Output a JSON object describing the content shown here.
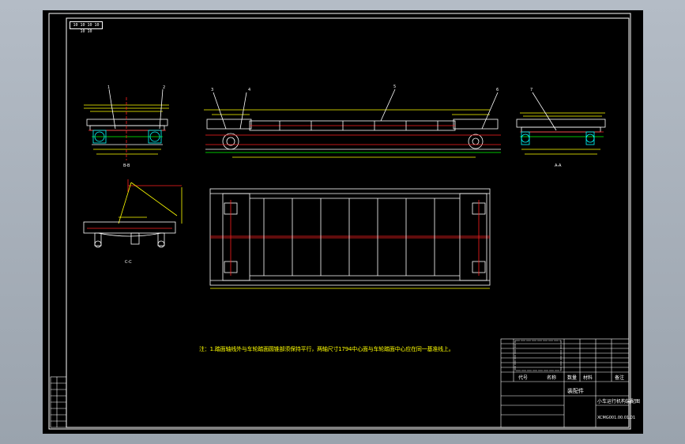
{
  "drawing": {
    "code_box": "10 10 10 10 10 10",
    "note": "注：1.踏面轴线外与车轮踏面圆锥部须保持平行，两轴尺寸1794中心面与车轮踏面中心应在同一基准线上。",
    "section_labels": [
      "B-B",
      "A-A",
      "C-C",
      "D-D"
    ],
    "part_numbers": [
      "1",
      "2",
      "3",
      "4",
      "5",
      "6",
      "7"
    ]
  },
  "title_block": {
    "header_cols": [
      "代号",
      "名称",
      "数量",
      "材料",
      "备注"
    ],
    "mid_label": "装配件",
    "drawing_name": "小车运行机构装配图",
    "drawing_number": "XCMG001.00.01.01"
  },
  "colors": {
    "white": "#ffffff",
    "yellow": "#ffff00",
    "red": "#ff2020",
    "green": "#00ff00",
    "cyan": "#00ffff",
    "magenta": "#ff00ff"
  }
}
